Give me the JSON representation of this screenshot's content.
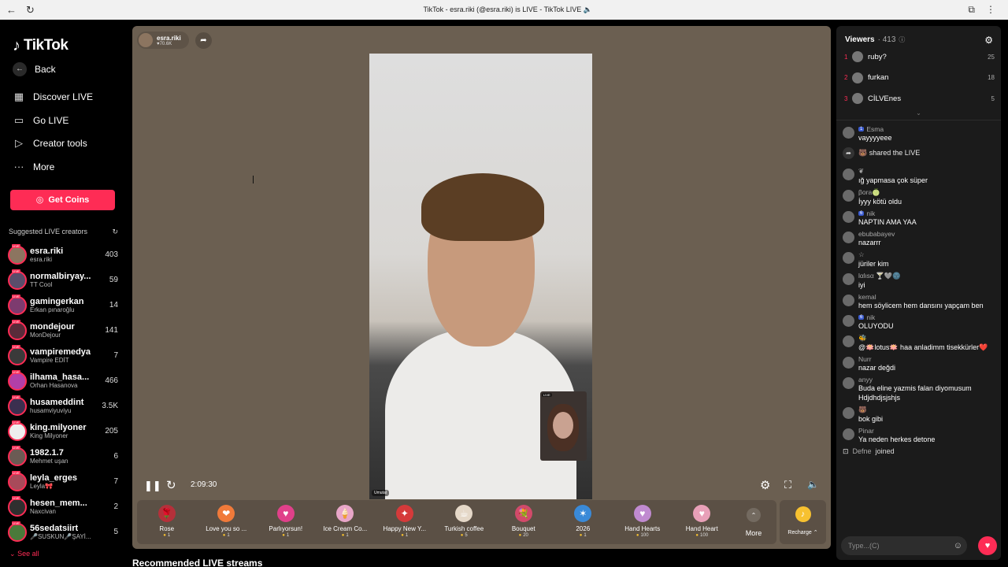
{
  "browser": {
    "title": "TikTok - esra.riki (@esra.riki) is LIVE - TikTok LIVE 🔈",
    "back_icon": "←",
    "reload_icon": "↻",
    "ext_icon": "⧉",
    "menu_icon": "⋮"
  },
  "sidebar": {
    "logo_text": "TikTok",
    "logo_icon": "♪",
    "nav": [
      {
        "label": "Back",
        "icon": "←"
      },
      {
        "label": "Discover LIVE",
        "icon": "▦"
      },
      {
        "label": "Go LIVE",
        "icon": "▭"
      },
      {
        "label": "Creator tools",
        "icon": "▷"
      },
      {
        "label": "More",
        "icon": "···"
      }
    ],
    "get_coins": "Get Coins",
    "coin_icon": "◎",
    "suggested_heading": "Suggested LIVE creators",
    "refresh_icon": "↻",
    "creators": [
      {
        "name": "esra.riki",
        "sub": "esra.riki",
        "count": "403",
        "color": "#8c7560"
      },
      {
        "name": "normalbiryay...",
        "sub": "TT Cool",
        "count": "59",
        "color": "#5a4d6b"
      },
      {
        "name": "gamingerkan",
        "sub": "Erkan pınaroğlu",
        "count": "14",
        "color": "#7d3b6f"
      },
      {
        "name": "mondejour",
        "sub": "MonDejour",
        "count": "141",
        "color": "#5a2b3a"
      },
      {
        "name": "vampiremedya",
        "sub": "Vampire EDİT",
        "count": "7",
        "color": "#3a3a3a"
      },
      {
        "name": "ilhama_hasa...",
        "sub": "Orhan Hasanova",
        "count": "466",
        "color": "#b23fa8"
      },
      {
        "name": "husameddint",
        "sub": "husamviyuviyu",
        "count": "3.5K",
        "color": "#3b2f4f"
      },
      {
        "name": "king.milyoner",
        "sub": "King Milyoner",
        "count": "205",
        "color": "#eeeeee"
      },
      {
        "name": "1982.1.7",
        "sub": "Mehmet uşan",
        "count": "6",
        "color": "#6b5b54"
      },
      {
        "name": "leyla_erges",
        "sub": "Leyla🎀",
        "count": "7",
        "color": "#a84a5a"
      },
      {
        "name": "hesen_mem...",
        "sub": "Naxcivan",
        "count": "2",
        "color": "#2f2f2f"
      },
      {
        "name": "56sedatsiirt",
        "sub": "🎤SUSKUN🎤ŞAYİ...",
        "count": "5",
        "color": "#4a7a3a"
      }
    ],
    "see_all": "See all",
    "see_all_icon": "⌄"
  },
  "stage": {
    "host_name": "esra.riki",
    "host_likes": "♥70.6K",
    "share_icon": "➦",
    "mini_tag": "LIVE",
    "video_tag": "Umutal",
    "time": "2:09:30",
    "pause_icon": "❚❚",
    "refresh_icon": "↻",
    "settings_icon": "⚙",
    "fullscreen_icon": "⛶",
    "volume_icon": "🔈"
  },
  "gifts": [
    {
      "name": "Rose",
      "price": "1",
      "icon": "🌹",
      "color": "#b5303a"
    },
    {
      "name": "Love you so ...",
      "price": "1",
      "icon": "❤",
      "color": "#f07a3a"
    },
    {
      "name": "Parlıyorsun!",
      "price": "1",
      "icon": "♥",
      "color": "#e0408a"
    },
    {
      "name": "Ice Cream Co...",
      "price": "1",
      "icon": "🍦",
      "color": "#e8a6c8"
    },
    {
      "name": "Happy New Y...",
      "price": "1",
      "icon": "✦",
      "color": "#d53a3a"
    },
    {
      "name": "Turkish coffee",
      "price": "5",
      "icon": "☕",
      "color": "#e5d8c8"
    },
    {
      "name": "Bouquet",
      "price": "20",
      "icon": "💐",
      "color": "#d24a6a"
    },
    {
      "name": "2026",
      "price": "1",
      "icon": "✶",
      "color": "#3a8ad8"
    },
    {
      "name": "Hand Hearts",
      "price": "100",
      "icon": "♥",
      "color": "#c08ad0"
    },
    {
      "name": "Hand Heart",
      "price": "100",
      "icon": "♥",
      "color": "#e8a0b8"
    }
  ],
  "more_label": "More",
  "more_icon": "⌃",
  "recharge_label": "Recharge ⌃",
  "recharge_icon": "♪",
  "recommended_title": "Recommended LIVE streams",
  "viewers_panel": {
    "title": "Viewers",
    "count": "· 413",
    "info_icon": "ⓘ",
    "settings_icon": "⚙",
    "top": [
      {
        "rank": "1",
        "name": "ruby?",
        "score": "25"
      },
      {
        "rank": "2",
        "name": "furkan",
        "score": "18"
      },
      {
        "rank": "3",
        "name": "CİLVEnes",
        "score": "5"
      }
    ],
    "expand_icon": "⌄"
  },
  "chat": [
    {
      "user": "Esma",
      "badge": "1",
      "text": "vayyyyeee"
    },
    {
      "type": "system",
      "icon": "➦",
      "text": "🐻 shared the LIVE"
    },
    {
      "user": "❦",
      "badge": "",
      "text": "ığ yapmasa çok süper"
    },
    {
      "user": "βora🍈",
      "badge": "",
      "text": "İyyy kötü oldu"
    },
    {
      "user": "nik",
      "badge": "6",
      "text": "NAPTIN AMA YAA"
    },
    {
      "user": "ebubabayev",
      "badge": "",
      "text": "nazarrr"
    },
    {
      "user": "☆",
      "badge": "",
      "text": "jüriler kim"
    },
    {
      "user": "lαlιѕα 🍸🩶🌚",
      "badge": "",
      "text": "iyi"
    },
    {
      "user": "kemal",
      "badge": "",
      "text": "hem söylicem hem dansını yapçam ben"
    },
    {
      "user": "nik",
      "badge": "6",
      "text": "OLUYODU"
    },
    {
      "user": "🐝",
      "badge": "",
      "text": "@🪷lotus🪷 haa anladimm tisekkürler❤️"
    },
    {
      "user": "Nurr",
      "badge": "",
      "text": "nazar değdi"
    },
    {
      "user": "anyy",
      "badge": "",
      "text": "Buda eline yazmis falan diyomusum Hdjdhdjsjshjs"
    },
    {
      "user": "🐻",
      "badge": "",
      "text": "bok gibi"
    },
    {
      "user": "Pinar",
      "badge": "",
      "text": "Ya neden herkes detone"
    }
  ],
  "joined": {
    "icon": "⊡",
    "user": "Defne",
    "text": "joined"
  },
  "chat_input": {
    "placeholder": "Type...(C)",
    "emoji_icon": "☺",
    "heart_icon": "♥"
  }
}
